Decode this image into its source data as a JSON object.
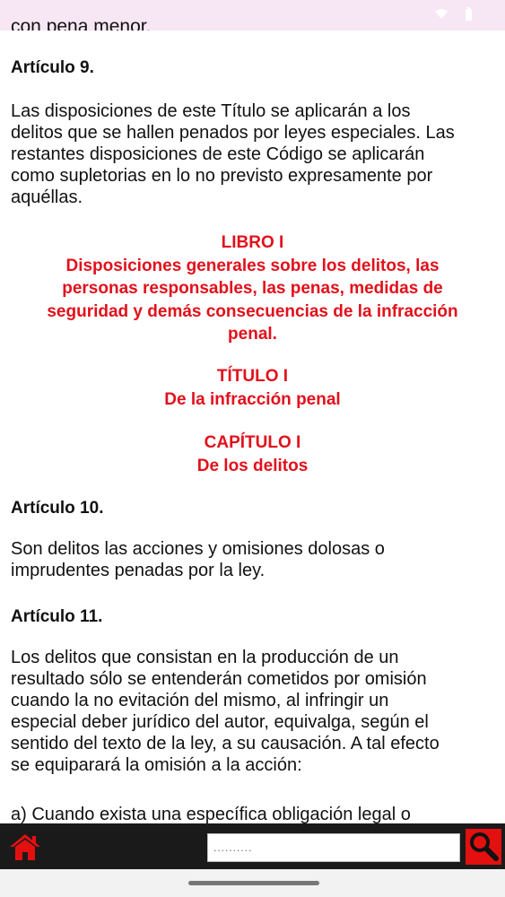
{
  "status_bar": {
    "wifi_icon": "wifi-icon",
    "battery_icon": "battery-icon"
  },
  "content": {
    "cut_line": "con pena menor.",
    "article9": {
      "title": "Artículo 9.",
      "lines": [
        "Las disposiciones de este Título se aplicarán a los",
        "delitos que se hallen penados por leyes especiales. Las",
        "restantes disposiciones de este Código se aplicarán",
        "como supletorias en lo no previsto expresamente por",
        "aquéllas."
      ]
    },
    "libro": {
      "heading": "LIBRO I",
      "lines": [
        "Disposiciones generales sobre los delitos, las",
        "personas responsables, las penas, medidas de",
        "seguridad y demás consecuencias de la infracción",
        "penal."
      ]
    },
    "titulo": {
      "heading": "TÍTULO I",
      "subheading": "De la infracción penal"
    },
    "capitulo": {
      "heading": "CAPÍTULO I",
      "subheading": "De los delitos"
    },
    "article10": {
      "title": "Artículo 10.",
      "lines": [
        "Son delitos las acciones y omisiones dolosas o",
        "imprudentes penadas por la ley."
      ]
    },
    "article11": {
      "title": "Artículo 11.",
      "lines": [
        "Los delitos que consistan en la producción de un",
        "resultado sólo se entenderán cometidos por omisión",
        "cuando la no evitación del mismo, al infringir un",
        "especial deber jurídico del autor, equivalga, según el",
        "sentido del texto de la ley, a su causación. A tal efecto",
        "se equiparará la omisión a la acción:"
      ],
      "item_a": "a) Cuando exista una específica obligación legal o"
    }
  },
  "bottom_bar": {
    "home_icon": "home-icon",
    "search_placeholder": "..........",
    "search_icon": "magnifier-icon"
  },
  "colors": {
    "heading_red": "#e2101b",
    "search_button": "#e31010",
    "toolbar_bg": "#1a1a1a"
  }
}
